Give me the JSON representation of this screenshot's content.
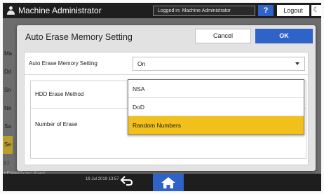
{
  "topbar": {
    "user_name": "Machine Administrator",
    "login_status": "Logged in: Machine Administrator",
    "help_label": "?",
    "logout_label": "Logout",
    "moon_label": "☾"
  },
  "background": {
    "row_labels": [
      "Ma",
      "Dd",
      "Sn",
      "Ne",
      "Sa",
      "Se",
      "r.i"
    ],
    "highlighted_index": 5,
    "bottom_text": "• Erase/Protect Board"
  },
  "bottombar": {
    "datetime": "19 Jul 2019 13:57",
    "back_glyph": "⮌"
  },
  "dialog": {
    "title": "Auto Erase Memory Setting",
    "cancel_label": "Cancel",
    "ok_label": "OK",
    "main_setting": {
      "label": "Auto Erase Memory Setting",
      "value": "On"
    },
    "hdd_erase_method": {
      "label": "HDD Erase Method"
    },
    "number_of_erase": {
      "label": "Number of Erase"
    }
  },
  "dropdown": {
    "options": [
      "NSA",
      "DoD",
      "Random Numbers"
    ],
    "selected": "Random Numbers"
  },
  "colors": {
    "accent_blue": "#2f63c7",
    "selection_yellow": "#f2c01a",
    "bar_dark": "#1e1e1e"
  }
}
